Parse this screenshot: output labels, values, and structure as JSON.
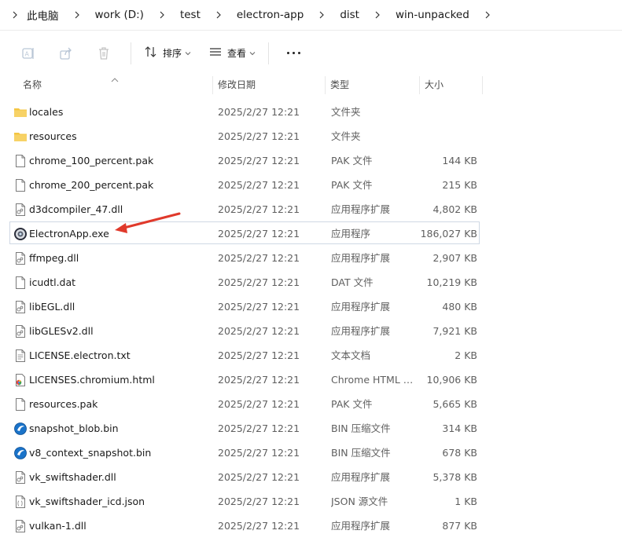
{
  "breadcrumb": {
    "items": [
      "此电脑",
      "work (D:)",
      "test",
      "electron-app",
      "dist",
      "win-unpacked"
    ]
  },
  "toolbar": {
    "sort_label": "排序",
    "view_label": "查看",
    "more_label": "..."
  },
  "columns": {
    "name": "名称",
    "date": "修改日期",
    "type": "类型",
    "size": "大小"
  },
  "files": [
    {
      "name": "locales",
      "date": "2025/2/27 12:21",
      "type": "文件夹",
      "size": "",
      "icon": "folder-icon"
    },
    {
      "name": "resources",
      "date": "2025/2/27 12:21",
      "type": "文件夹",
      "size": "",
      "icon": "folder-icon"
    },
    {
      "name": "chrome_100_percent.pak",
      "date": "2025/2/27 12:21",
      "type": "PAK 文件",
      "size": "144 KB",
      "icon": "file-icon"
    },
    {
      "name": "chrome_200_percent.pak",
      "date": "2025/2/27 12:21",
      "type": "PAK 文件",
      "size": "215 KB",
      "icon": "file-icon"
    },
    {
      "name": "d3dcompiler_47.dll",
      "date": "2025/2/27 12:21",
      "type": "应用程序扩展",
      "size": "4,802 KB",
      "icon": "dll-icon"
    },
    {
      "name": "ElectronApp.exe",
      "date": "2025/2/27 12:21",
      "type": "应用程序",
      "size": "186,027 KB",
      "icon": "electron-app-icon"
    },
    {
      "name": "ffmpeg.dll",
      "date": "2025/2/27 12:21",
      "type": "应用程序扩展",
      "size": "2,907 KB",
      "icon": "dll-icon"
    },
    {
      "name": "icudtl.dat",
      "date": "2025/2/27 12:21",
      "type": "DAT 文件",
      "size": "10,219 KB",
      "icon": "file-icon"
    },
    {
      "name": "libEGL.dll",
      "date": "2025/2/27 12:21",
      "type": "应用程序扩展",
      "size": "480 KB",
      "icon": "dll-icon"
    },
    {
      "name": "libGLESv2.dll",
      "date": "2025/2/27 12:21",
      "type": "应用程序扩展",
      "size": "7,921 KB",
      "icon": "dll-icon"
    },
    {
      "name": "LICENSE.electron.txt",
      "date": "2025/2/27 12:21",
      "type": "文本文档",
      "size": "2 KB",
      "icon": "text-file-icon"
    },
    {
      "name": "LICENSES.chromium.html",
      "date": "2025/2/27 12:21",
      "type": "Chrome HTML D...",
      "size": "10,906 KB",
      "icon": "chrome-html-icon"
    },
    {
      "name": "resources.pak",
      "date": "2025/2/27 12:21",
      "type": "PAK 文件",
      "size": "5,665 KB",
      "icon": "file-icon"
    },
    {
      "name": "snapshot_blob.bin",
      "date": "2025/2/27 12:21",
      "type": "BIN 压缩文件",
      "size": "314 KB",
      "icon": "bin-icon"
    },
    {
      "name": "v8_context_snapshot.bin",
      "date": "2025/2/27 12:21",
      "type": "BIN 压缩文件",
      "size": "678 KB",
      "icon": "bin-icon"
    },
    {
      "name": "vk_swiftshader.dll",
      "date": "2025/2/27 12:21",
      "type": "应用程序扩展",
      "size": "5,378 KB",
      "icon": "dll-icon"
    },
    {
      "name": "vk_swiftshader_icd.json",
      "date": "2025/2/27 12:21",
      "type": "JSON 源文件",
      "size": "1 KB",
      "icon": "json-file-icon"
    },
    {
      "name": "vulkan-1.dll",
      "date": "2025/2/27 12:21",
      "type": "应用程序扩展",
      "size": "877 KB",
      "icon": "dll-icon"
    }
  ],
  "selected_index": 5,
  "colors": {
    "annotation_arrow": "#e0392b",
    "folder": "#f4c542",
    "selection_border": "#cfd8e4"
  }
}
